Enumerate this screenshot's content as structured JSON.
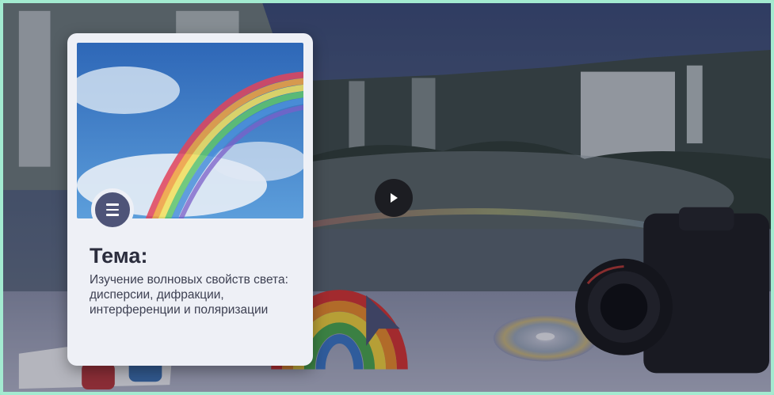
{
  "card": {
    "title": "Тема:",
    "description": "Изучение волновых свойств света: дисперсии, дифракции, интерференции и поляризации"
  },
  "icons": {
    "menu": "menu-icon",
    "play": "play-icon"
  },
  "colors": {
    "frame_border": "#a3ead0",
    "card_bg": "#eef0f6",
    "menu_button": "#4e5478",
    "play_button": "#1c1d22"
  }
}
